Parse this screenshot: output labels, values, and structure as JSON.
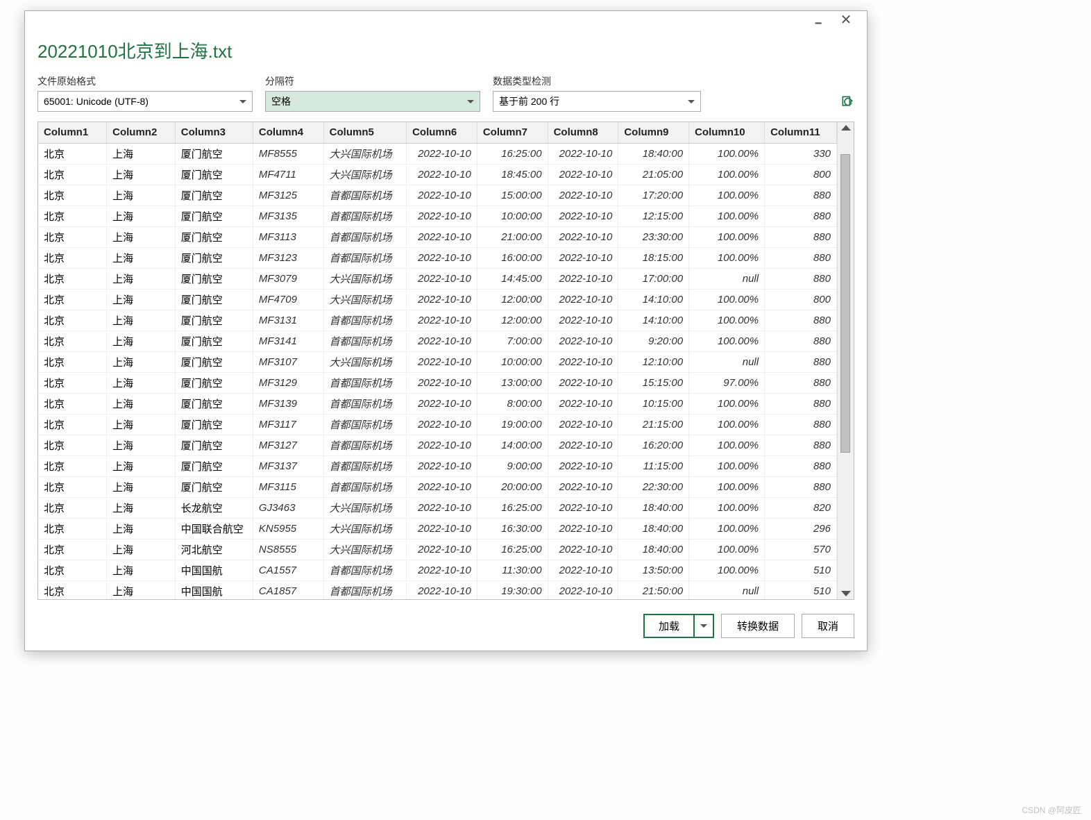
{
  "window": {
    "title": "20221010北京到上海.txt"
  },
  "options": {
    "format_label": "文件原始格式",
    "format_value": "65001: Unicode (UTF-8)",
    "delimiter_label": "分隔符",
    "delimiter_value": "空格",
    "detect_label": "数据类型检测",
    "detect_value": "基于前 200 行"
  },
  "columns": [
    "Column1",
    "Column2",
    "Column3",
    "Column4",
    "Column5",
    "Column6",
    "Column7",
    "Column8",
    "Column9",
    "Column10",
    "Column11"
  ],
  "rows": [
    [
      "北京",
      "上海",
      "厦门航空",
      "MF8555",
      "大兴国际机场",
      "2022-10-10",
      "16:25:00",
      "2022-10-10",
      "18:40:00",
      "100.00%",
      "330"
    ],
    [
      "北京",
      "上海",
      "厦门航空",
      "MF4711",
      "大兴国际机场",
      "2022-10-10",
      "18:45:00",
      "2022-10-10",
      "21:05:00",
      "100.00%",
      "800"
    ],
    [
      "北京",
      "上海",
      "厦门航空",
      "MF3125",
      "首都国际机场",
      "2022-10-10",
      "15:00:00",
      "2022-10-10",
      "17:20:00",
      "100.00%",
      "880"
    ],
    [
      "北京",
      "上海",
      "厦门航空",
      "MF3135",
      "首都国际机场",
      "2022-10-10",
      "10:00:00",
      "2022-10-10",
      "12:15:00",
      "100.00%",
      "880"
    ],
    [
      "北京",
      "上海",
      "厦门航空",
      "MF3113",
      "首都国际机场",
      "2022-10-10",
      "21:00:00",
      "2022-10-10",
      "23:30:00",
      "100.00%",
      "880"
    ],
    [
      "北京",
      "上海",
      "厦门航空",
      "MF3123",
      "首都国际机场",
      "2022-10-10",
      "16:00:00",
      "2022-10-10",
      "18:15:00",
      "100.00%",
      "880"
    ],
    [
      "北京",
      "上海",
      "厦门航空",
      "MF3079",
      "大兴国际机场",
      "2022-10-10",
      "14:45:00",
      "2022-10-10",
      "17:00:00",
      "null",
      "880"
    ],
    [
      "北京",
      "上海",
      "厦门航空",
      "MF4709",
      "大兴国际机场",
      "2022-10-10",
      "12:00:00",
      "2022-10-10",
      "14:10:00",
      "100.00%",
      "800"
    ],
    [
      "北京",
      "上海",
      "厦门航空",
      "MF3131",
      "首都国际机场",
      "2022-10-10",
      "12:00:00",
      "2022-10-10",
      "14:10:00",
      "100.00%",
      "880"
    ],
    [
      "北京",
      "上海",
      "厦门航空",
      "MF3141",
      "首都国际机场",
      "2022-10-10",
      "7:00:00",
      "2022-10-10",
      "9:20:00",
      "100.00%",
      "880"
    ],
    [
      "北京",
      "上海",
      "厦门航空",
      "MF3107",
      "大兴国际机场",
      "2022-10-10",
      "10:00:00",
      "2022-10-10",
      "12:10:00",
      "null",
      "880"
    ],
    [
      "北京",
      "上海",
      "厦门航空",
      "MF3129",
      "首都国际机场",
      "2022-10-10",
      "13:00:00",
      "2022-10-10",
      "15:15:00",
      "97.00%",
      "880"
    ],
    [
      "北京",
      "上海",
      "厦门航空",
      "MF3139",
      "首都国际机场",
      "2022-10-10",
      "8:00:00",
      "2022-10-10",
      "10:15:00",
      "100.00%",
      "880"
    ],
    [
      "北京",
      "上海",
      "厦门航空",
      "MF3117",
      "首都国际机场",
      "2022-10-10",
      "19:00:00",
      "2022-10-10",
      "21:15:00",
      "100.00%",
      "880"
    ],
    [
      "北京",
      "上海",
      "厦门航空",
      "MF3127",
      "首都国际机场",
      "2022-10-10",
      "14:00:00",
      "2022-10-10",
      "16:20:00",
      "100.00%",
      "880"
    ],
    [
      "北京",
      "上海",
      "厦门航空",
      "MF3137",
      "首都国际机场",
      "2022-10-10",
      "9:00:00",
      "2022-10-10",
      "11:15:00",
      "100.00%",
      "880"
    ],
    [
      "北京",
      "上海",
      "厦门航空",
      "MF3115",
      "首都国际机场",
      "2022-10-10",
      "20:00:00",
      "2022-10-10",
      "22:30:00",
      "100.00%",
      "880"
    ],
    [
      "北京",
      "上海",
      "长龙航空",
      "GJ3463",
      "大兴国际机场",
      "2022-10-10",
      "16:25:00",
      "2022-10-10",
      "18:40:00",
      "100.00%",
      "820"
    ],
    [
      "北京",
      "上海",
      "中国联合航空",
      "KN5955",
      "大兴国际机场",
      "2022-10-10",
      "16:30:00",
      "2022-10-10",
      "18:40:00",
      "100.00%",
      "296"
    ],
    [
      "北京",
      "上海",
      "河北航空",
      "NS8555",
      "大兴国际机场",
      "2022-10-10",
      "16:25:00",
      "2022-10-10",
      "18:40:00",
      "100.00%",
      "570"
    ],
    [
      "北京",
      "上海",
      "中国国航",
      "CA1557",
      "首都国际机场",
      "2022-10-10",
      "11:30:00",
      "2022-10-10",
      "13:50:00",
      "100.00%",
      "510"
    ],
    [
      "北京",
      "上海",
      "中国国航",
      "CA1857",
      "首都国际机场",
      "2022-10-10",
      "19:30:00",
      "2022-10-10",
      "21:50:00",
      "null",
      "510"
    ]
  ],
  "footer": {
    "load": "加载",
    "transform": "转换数据",
    "cancel": "取消"
  },
  "watermark": "CSDN @阿皮匠"
}
